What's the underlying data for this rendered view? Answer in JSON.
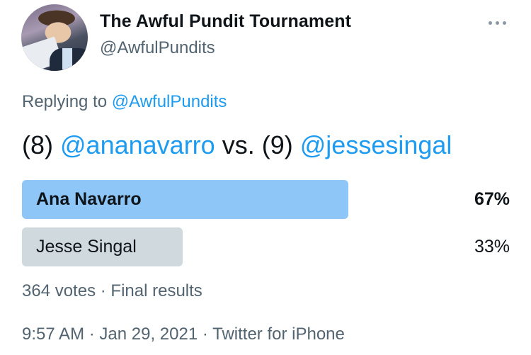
{
  "author": {
    "display_name": "The Awful Pundit Tournament",
    "handle": "@AwfulPundits"
  },
  "reply": {
    "prefix": "Replying to",
    "mention": "@AwfulPundits"
  },
  "tweet": {
    "seed_a": "(8)",
    "mention_a": "@ananavarro",
    "vs": "vs.",
    "seed_b": "(9)",
    "mention_b": "@jessesingal"
  },
  "poll": {
    "options": [
      {
        "label": "Ana Navarro",
        "percent_text": "67%",
        "percent": 67,
        "winner": true,
        "color": "#8ec6f7"
      },
      {
        "label": "Jesse Singal",
        "percent_text": "33%",
        "percent": 33,
        "winner": false,
        "color": "#cfd9de"
      }
    ],
    "votes": "364 votes",
    "separator": "·",
    "status": "Final results"
  },
  "meta": {
    "time": "9:57 AM",
    "date": "Jan 29, 2021",
    "source": "Twitter for iPhone",
    "separator": "·"
  },
  "icons": {
    "more": "more-horizontal-icon",
    "avatar": "profile-avatar"
  },
  "colors": {
    "link": "#1d9bf0",
    "secondary_text": "#536471",
    "winner_bar": "#8ec6f7",
    "loser_bar": "#cfd9de"
  }
}
